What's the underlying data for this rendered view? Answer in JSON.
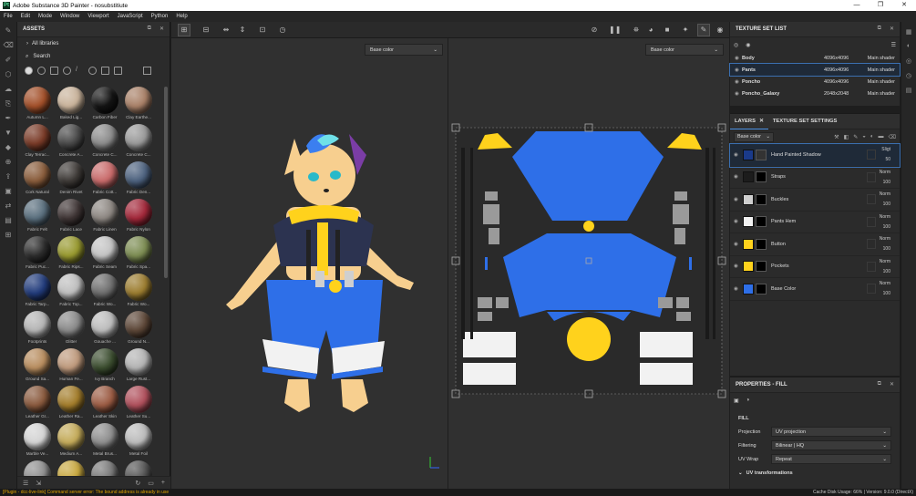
{
  "window": {
    "title": "Adobe Substance 3D Painter - nosubstitiute",
    "app_icon": "Pt",
    "controls": [
      "—",
      "❐",
      "✕"
    ]
  },
  "menu": [
    "File",
    "Edit",
    "Mode",
    "Window",
    "Viewport",
    "JavaScript",
    "Python",
    "Help"
  ],
  "assets": {
    "title": "ASSETS",
    "library": "All libraries",
    "search_placeholder": "Search",
    "materials": [
      {
        "label": "Autumn L...",
        "c": "#a3502a"
      },
      {
        "label": "Baked Lig...",
        "c": "#c9b39b"
      },
      {
        "label": "Carbon Fiber",
        "c": "#141414"
      },
      {
        "label": "Clay Earthe...",
        "c": "#a98168"
      },
      {
        "label": "Clay Terrac...",
        "c": "#7a3b28"
      },
      {
        "label": "Concrete A...",
        "c": "#4a4a4a"
      },
      {
        "label": "Concrete C...",
        "c": "#8c8c8c"
      },
      {
        "label": "Concrete C...",
        "c": "#9a9a9a"
      },
      {
        "label": "Cork Natural",
        "c": "#8a5d3c"
      },
      {
        "label": "Denim Rivet",
        "c": "#3e3a37"
      },
      {
        "label": "Fabric Cott...",
        "c": "#c96b6b"
      },
      {
        "label": "Fabric Den...",
        "c": "#4d627f"
      },
      {
        "label": "Fabric Felt",
        "c": "#5a6f7e"
      },
      {
        "label": "Fabric Lace",
        "c": "#3f3535"
      },
      {
        "label": "Fabric Linen",
        "c": "#8d8782"
      },
      {
        "label": "Fabric Nylon",
        "c": "#a3283a"
      },
      {
        "label": "Fabric Puc...",
        "c": "#2d2d2d"
      },
      {
        "label": "Fabric Rips...",
        "c": "#98992f"
      },
      {
        "label": "Fabric Seam",
        "c": "#c4c4c4"
      },
      {
        "label": "Fabric Spa...",
        "c": "#7c8c52"
      },
      {
        "label": "Fabric Tarp...",
        "c": "#223c7c"
      },
      {
        "label": "Fabric Top...",
        "c": "#bfbfbf"
      },
      {
        "label": "Fabric Wo...",
        "c": "#6e6e6e"
      },
      {
        "label": "Fabric Wo...",
        "c": "#9c7d30"
      },
      {
        "label": "Footprints",
        "c": "#b5b5b5"
      },
      {
        "label": "Glitter",
        "c": "#8a8a8a"
      },
      {
        "label": "Gouache ...",
        "c": "#bcbcbc"
      },
      {
        "label": "Ground N...",
        "c": "#5c4637"
      },
      {
        "label": "Ground Sa...",
        "c": "#b88d5f"
      },
      {
        "label": "Human Fe...",
        "c": "#bf9a7d"
      },
      {
        "label": "Ivy Branch",
        "c": "#3b4d2f"
      },
      {
        "label": "Large Rust...",
        "c": "#b4b4b4"
      },
      {
        "label": "Leather Gr...",
        "c": "#8a5a3e"
      },
      {
        "label": "Leather Ra...",
        "c": "#a37d2b"
      },
      {
        "label": "Leather Skin",
        "c": "#9c5c44"
      },
      {
        "label": "Leather Su...",
        "c": "#b0505c"
      },
      {
        "label": "Marble Ve...",
        "c": "#d4d4d4"
      },
      {
        "label": "Medium A...",
        "c": "#c4ab5a"
      },
      {
        "label": "Metal Brus...",
        "c": "#8e8e8e"
      },
      {
        "label": "Metal Foil",
        "c": "#bcbcbc"
      },
      {
        "label": "",
        "c": "#909090"
      },
      {
        "label": "",
        "c": "#c8a840"
      },
      {
        "label": "",
        "c": "#7a7a7a"
      },
      {
        "label": "",
        "c": "#555555"
      }
    ]
  },
  "viewport": {
    "channel_left": "Base color",
    "channel_right": "Base color"
  },
  "texture_set_list": {
    "title": "TEXTURE SET LIST",
    "rows": [
      {
        "name": "Body",
        "res": "4096x4096",
        "shader": "Main shader"
      },
      {
        "name": "Pants",
        "res": "4096x4096",
        "shader": "Main shader"
      },
      {
        "name": "Poncho",
        "res": "4096x4096",
        "shader": "Main shader"
      },
      {
        "name": "Poncho_Galaxy",
        "res": "2048x2048",
        "shader": "Main shader"
      }
    ]
  },
  "layers": {
    "tab1": "LAYERS",
    "tab2": "TEXTURE SET SETTINGS",
    "channel": "Base color",
    "rows": [
      {
        "name": "Hand Painted Shadow",
        "blend": "Sligt",
        "op": "50",
        "c": "#1a3a8a"
      },
      {
        "name": "Straps",
        "blend": "Norm",
        "op": "100",
        "c": "#1c1c1c"
      },
      {
        "name": "Buckles",
        "blend": "Norm",
        "op": "100",
        "c": "#cfcfcf"
      },
      {
        "name": "Pants Hem",
        "blend": "Norm",
        "op": "100",
        "c": "#f2f2f2"
      },
      {
        "name": "Button",
        "blend": "Norm",
        "op": "100",
        "c": "#ffd21c"
      },
      {
        "name": "Pockets",
        "blend": "Norm",
        "op": "100",
        "c": "#ffd21c"
      },
      {
        "name": "Base Color",
        "blend": "Norm",
        "op": "100",
        "c": "#2e6fe8"
      }
    ]
  },
  "properties": {
    "title": "PROPERTIES - FILL",
    "section": "FILL",
    "projection_label": "Projection",
    "projection_value": "UV projection",
    "filtering_label": "Filtering",
    "filtering_value": "Bilinear | HQ",
    "uvwrap_label": "UV Wrap",
    "uvwrap_value": "Repeat",
    "uv_transformations": "UV transformations"
  },
  "status": {
    "error": "[Plugin - dcc-live-link] Command server error: The bound address is already in use",
    "right": "Cache Disk Usage:  66% | Version: 9.0.0 (DirectX)"
  }
}
